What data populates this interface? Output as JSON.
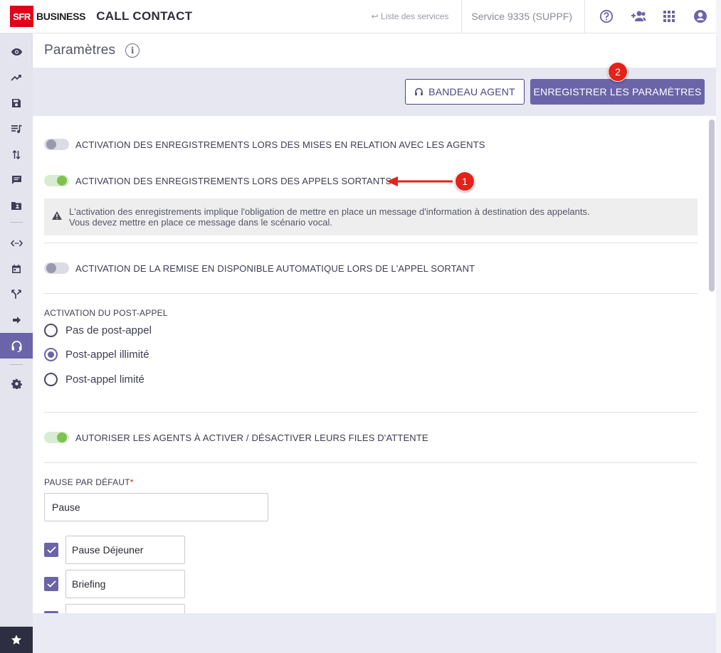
{
  "header": {
    "logo_mark": "SFR",
    "logo_text": "BUSINESS",
    "app_title": "CALL CONTACT",
    "back_link": "↩ Liste des services",
    "service": "Service 9335 (SUPPF)",
    "icons": [
      "help-icon",
      "add-user-icon",
      "apps-grid-icon",
      "account-icon"
    ]
  },
  "sidebar": {
    "icons": [
      "eye-icon",
      "trending-icon",
      "save-icon",
      "playlist-icon",
      "sort-icon",
      "message-icon",
      "folder-account-icon",
      "code-icon",
      "calendar-icon",
      "call-split-icon",
      "arrow-right-icon",
      "headset-icon",
      "settings-icon",
      "star-icon"
    ],
    "active": "headset-icon"
  },
  "page": {
    "title": "Paramètres"
  },
  "actions": {
    "bandeau_label": "BANDEAU AGENT",
    "save_label": "ENREGISTRER LES PARAMÈTRES"
  },
  "annotations": {
    "badge_1": "1",
    "badge_2": "2"
  },
  "settings": {
    "toggle_record_agents": {
      "label": "ACTIVATION DES ENREGISTREMENTS LORS DES MISES EN RELATION AVEC LES AGENTS",
      "on": false
    },
    "toggle_record_outgoing": {
      "label": "ACTIVATION DES ENREGISTREMENTS LORS DES APPELS SORTANTS",
      "on": true
    },
    "warning_line1": "L'activation des enregistrements implique l'obligation de mettre en place un message d'information à destination des appelants.",
    "warning_line2": "Vous devez mettre en place ce message dans le scénario vocal.",
    "toggle_auto_available": {
      "label": "ACTIVATION DE LA REMISE EN DISPONIBLE AUTOMATIQUE LORS DE L'APPEL SORTANT",
      "on": false
    },
    "post_call": {
      "label": "ACTIVATION DU POST-APPEL",
      "options": [
        "Pas de post-appel",
        "Post-appel illimité",
        "Post-appel limité"
      ],
      "selected": "Post-appel illimité"
    },
    "toggle_agents_queues": {
      "label": "AUTORISER LES AGENTS À ACTIVER / DÉSACTIVER LEURS FILES D'ATTENTE",
      "on": true
    },
    "default_pause": {
      "label": "PAUSE PAR DÉFAUT",
      "required_mark": "*",
      "value": "Pause"
    },
    "pauses": [
      {
        "label": "Pause Déjeuner",
        "checked": true
      },
      {
        "label": "Briefing",
        "checked": true
      }
    ]
  },
  "colors": {
    "accent": "#6b64a8",
    "brand_red": "#e2001a",
    "toggle_on": "#7dc24f",
    "annotation_red": "#e2231a"
  }
}
